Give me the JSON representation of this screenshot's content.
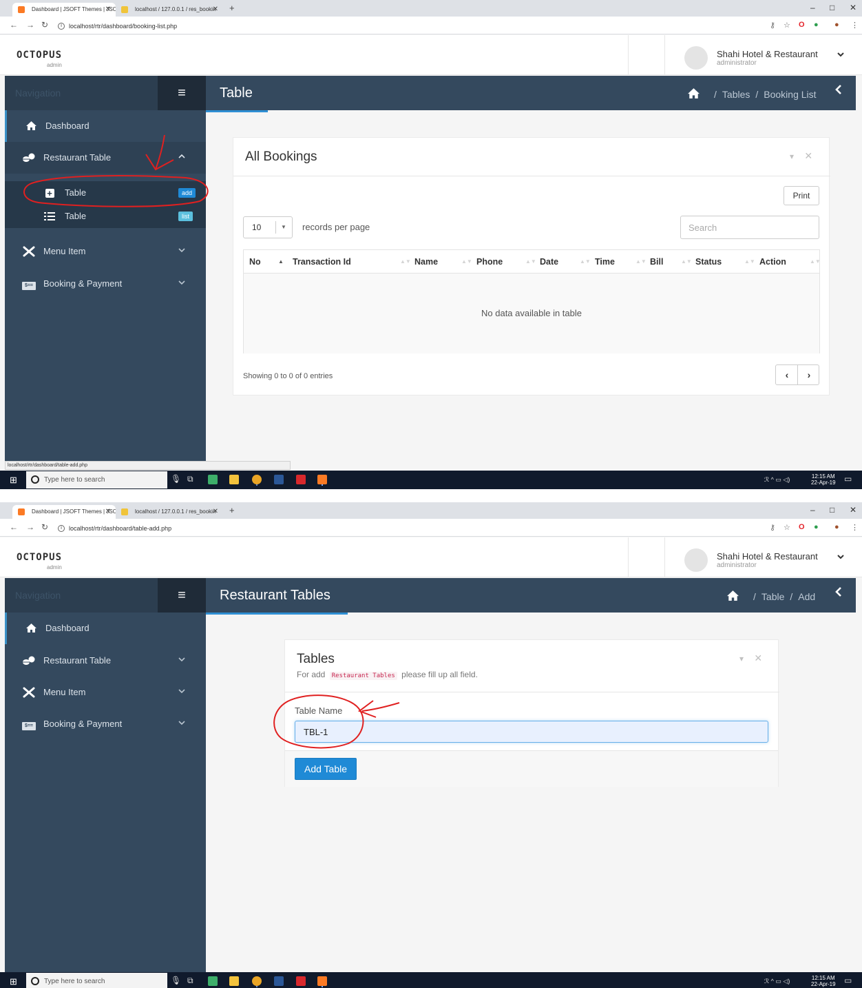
{
  "browser": {
    "tabs": [
      {
        "title": "Dashboard | JSOFT Themes | JSO"
      },
      {
        "title": "localhost / 127.0.0.1 / res_bookin"
      }
    ],
    "new_tab_label": "+",
    "window_controls": {
      "minimize": "–",
      "restore": "□",
      "close": "✕"
    }
  },
  "app": {
    "logo": "OCTOPUS",
    "logo_sub": "admin",
    "user_name": "Shahi Hotel & Restaurant",
    "user_role": "administrator"
  },
  "sidebar": {
    "nav_label": "Navigation",
    "items": {
      "dashboard": "Dashboard",
      "restaurant_table": "Restaurant Table",
      "table_add": "Table",
      "table_add_badge": "add",
      "table_list": "Table",
      "table_list_badge": "list",
      "menu_item": "Menu Item",
      "booking_payment": "Booking & Payment"
    }
  },
  "screen1": {
    "url": "localhost/rtr/dashboard/booking-list.php",
    "page_title": "Table",
    "breadcrumb": [
      "Tables",
      "Booking List"
    ],
    "panel_title": "All Bookings",
    "print_label": "Print",
    "page_length": "10",
    "records_label": "records per page",
    "search_placeholder": "Search",
    "columns": [
      "No",
      "Transaction Id",
      "Name",
      "Phone",
      "Date",
      "Time",
      "Bill",
      "Status",
      "Action"
    ],
    "empty_message": "No data available in table",
    "info": "Showing 0 to 0 of 0 entries",
    "status_url": "localhost/rtr/dashboard/table-add.php"
  },
  "screen2": {
    "url": "localhost/rtr/dashboard/table-add.php",
    "page_title": "Restaurant Tables",
    "breadcrumb": [
      "Table",
      "Add"
    ],
    "panel_title": "Tables",
    "subtitle_prefix": "For add",
    "subtitle_code": "Restaurant Tables",
    "subtitle_suffix": "please fill up all field.",
    "field_label": "Table Name",
    "field_value": "TBL-1",
    "submit_label": "Add Table"
  },
  "taskbar": {
    "search_placeholder": "Type here to search",
    "time": "12:15 AM",
    "date": "22-Apr-19"
  },
  "colors": {
    "sidebar": "#34495e",
    "sidebar_dark": "#2c3e50",
    "accent": "#1f8ad6",
    "annotation": "#e02020"
  },
  "icons": {
    "dashboard": "home-icon",
    "restaurant_table": "pills-icon",
    "table_add": "plus-square-icon",
    "table_list": "list-icon",
    "menu_item": "cutlery-icon",
    "booking_payment": "payment-card-icon"
  }
}
